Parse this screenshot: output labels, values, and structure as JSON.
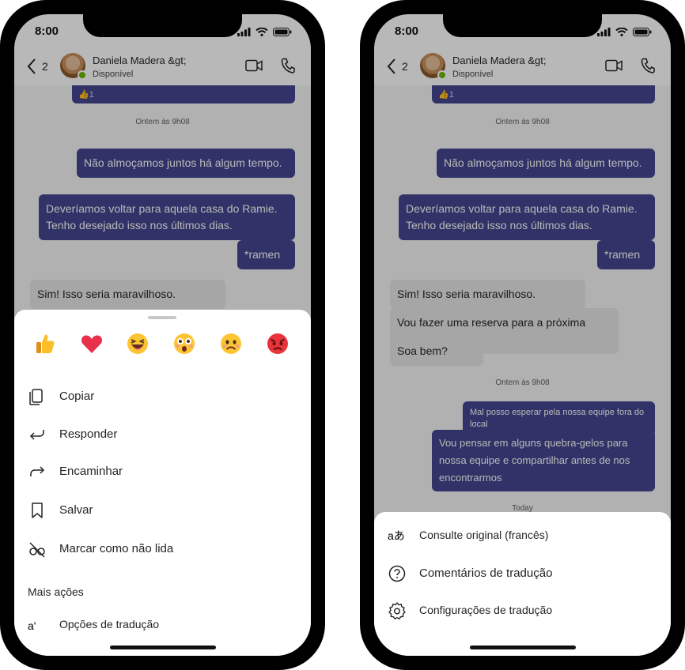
{
  "status": {
    "time": "8:00"
  },
  "header": {
    "back_count": "2",
    "contact_name": "Daniela Madera &gt;",
    "contact_status": "Disponível"
  },
  "colors": {
    "accent": "#444791",
    "received": "#e6e6e6",
    "presence": "#6bb700"
  },
  "messages": {
    "top_reaction": "1",
    "timestamp_1": "Ontem às 9h08",
    "out_1": "Não almoçamos juntos há algum tempo.",
    "out_2": "Deveríamos voltar para aquela casa do Ramie. Tenho desejado isso nos últimos dias.",
    "out_3": "*ramen",
    "in_1": "Sim! Isso seria maravilhoso.",
    "in_2": "Vou fazer uma reserva para a próxima semana.",
    "in_3": "Soa bem?",
    "timestamp_2": "Ontem às 9h08",
    "out_4": "Mal posso esperar pela nossa equipe fora do local",
    "out_5": "Vou pensar em alguns quebra-gelos para nossa equipe e compartilhar antes de nos encontrarmos",
    "timestamp_3": "Today"
  },
  "reactions": [
    "like",
    "heart",
    "laugh",
    "surprised",
    "sad",
    "angry"
  ],
  "actions_menu": {
    "copy": "Copiar",
    "reply": "Responder",
    "forward": "Encaminhar",
    "save": "Salvar",
    "mark_unread": "Marcar como não lida",
    "more_actions": "Mais ações",
    "translation_options": "Opções de tradução",
    "translation_icon_text": "a'"
  },
  "translation_menu": {
    "translate_icon_text": "aあ",
    "see_original": "Consulte original (francês)",
    "feedback": "Comentários de tradução",
    "settings": "Configurações de tradução"
  }
}
